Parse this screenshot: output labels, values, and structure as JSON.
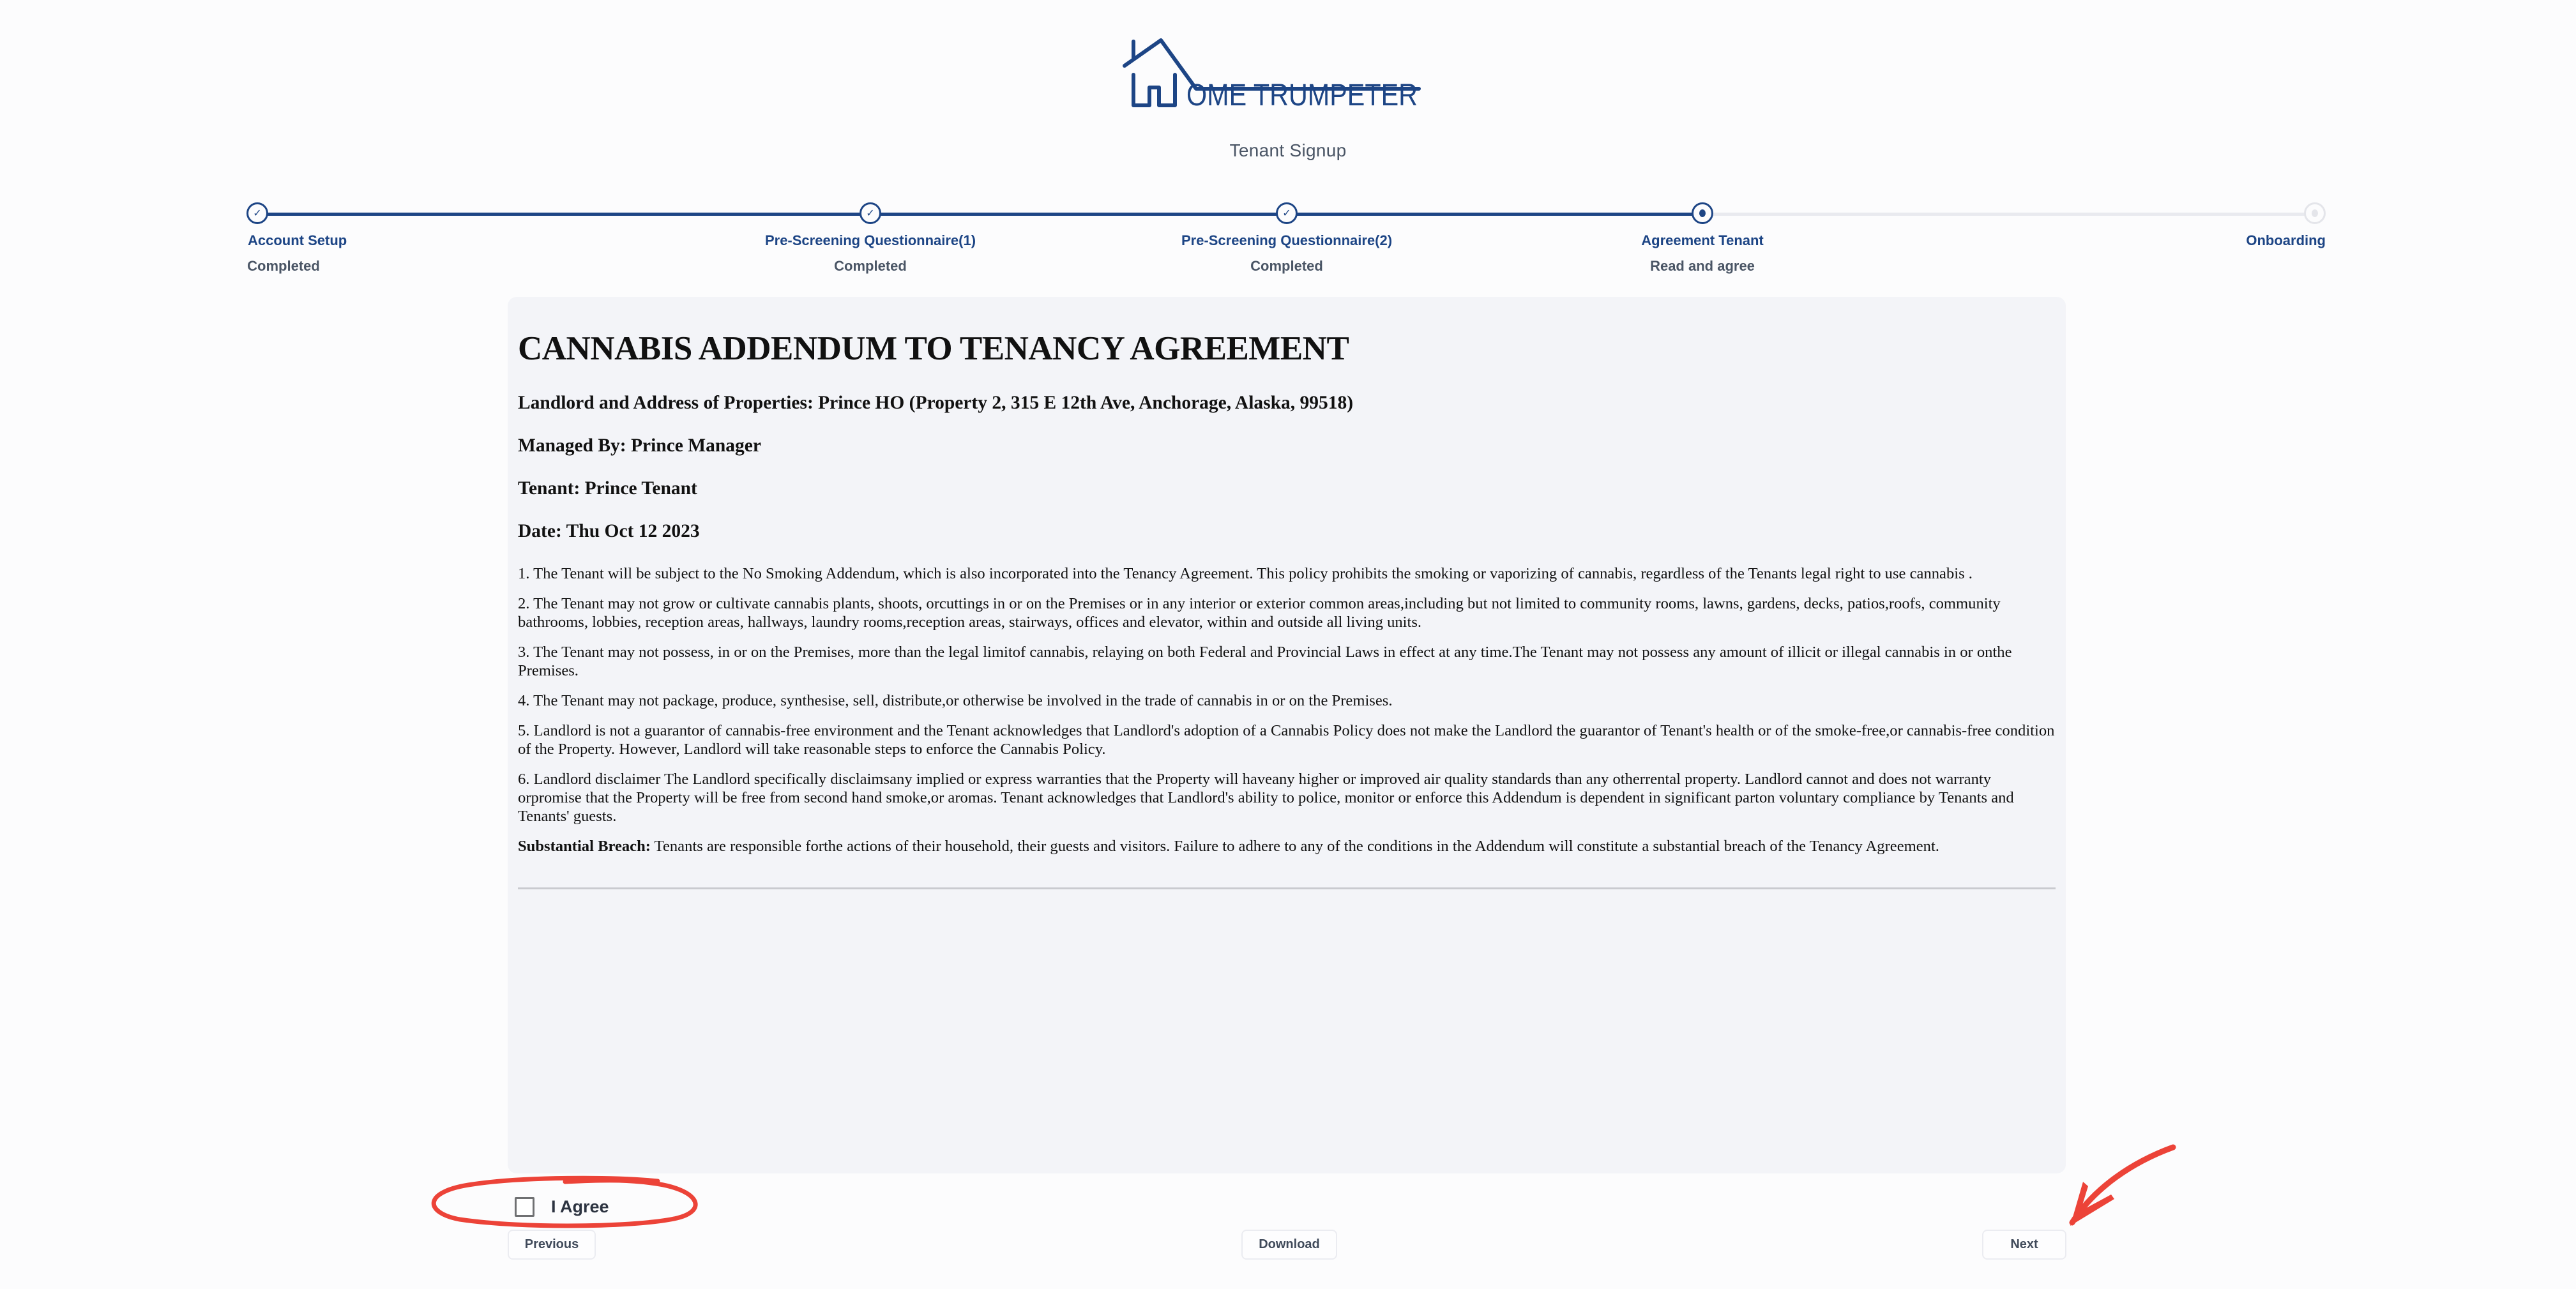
{
  "brand": {
    "logo_text": "OME TRUMPETER",
    "logo_color": "#1d4585"
  },
  "subtitle": "Tenant Signup",
  "stepper": {
    "steps": [
      {
        "label": "Account Setup",
        "status": "Completed",
        "state": "done",
        "icon": "check-icon"
      },
      {
        "label": "Pre-Screening Questionnaire(1)",
        "status": "Completed",
        "state": "done",
        "icon": "check-icon"
      },
      {
        "label": "Pre-Screening Questionnaire(2)",
        "status": "Completed",
        "state": "done",
        "icon": "check-icon"
      },
      {
        "label": "Agreement Tenant",
        "status": "Read and agree",
        "state": "current",
        "icon": "dot-icon"
      },
      {
        "label": "Onboarding",
        "status": "",
        "state": "todo",
        "icon": "dot-icon"
      }
    ],
    "active_color": "#1d4585",
    "inactive_color": "#e9eaef"
  },
  "document": {
    "title": "CANNABIS ADDENDUM TO TENANCY AGREEMENT",
    "landlord": "Landlord and Address of Properties: Prince HO (Property 2, 315 E 12th Ave, Anchorage, Alaska, 99518)",
    "managed_by": "Managed By: Prince Manager",
    "tenant": "Tenant: Prince Tenant",
    "date": "Date: Thu Oct 12 2023",
    "clauses": [
      "1. The Tenant will be subject to the No Smoking Addendum, which is also incorporated into the Tenancy Agreement. This policy prohibits the smoking or vaporizing of cannabis, regardless of the Tenants legal right to use cannabis .",
      "2. The Tenant may not grow or cultivate cannabis plants, shoots, orcuttings in or on the Premises or in any interior or exterior common areas,including but not limited to community rooms, lawns, gardens, decks, patios,roofs, community bathrooms, lobbies, reception areas, hallways, laundry rooms,reception areas, stairways, offices and elevator, within and outside all living units.",
      "3. The Tenant may not possess, in or on the Premises, more than the legal limitof cannabis, relaying on both Federal and Provincial Laws in effect at any time.The Tenant may not possess any amount of illicit or illegal cannabis in or onthe Premises.",
      "4. The Tenant may not package, produce, synthesise, sell, distribute,or otherwise be involved in the trade of cannabis in or on the Premises.",
      "5. Landlord is not a guarantor of cannabis-free environment and the Tenant acknowledges that Landlord's adoption of a Cannabis Policy does not make the Landlord the guarantor of Tenant's health or of the smoke-free,or cannabis-free condition of the Property. However, Landlord will take reasonable steps to enforce the Cannabis Policy.",
      "6. Landlord disclaimer The Landlord specifically disclaimsany implied or express warranties that the Property will haveany higher or improved air quality standards than any otherrental property. Landlord cannot and does not warranty orpromise that the Property will be free from second hand smoke,or aromas. Tenant acknowledges that Landlord's ability to police, monitor or enforce this Addendum is dependent in significant parton voluntary compliance by Tenants and Tenants' guests."
    ],
    "breach_label": "Substantial Breach:",
    "breach_text": " Tenants are responsible forthe actions of their household, their guests and visitors. Failure to adhere to any of the conditions in the Addendum will constitute a substantial breach of the Tenancy Agreement."
  },
  "agree": {
    "label": "I Agree",
    "checked": false
  },
  "buttons": {
    "previous": "Previous",
    "download": "Download",
    "next": "Next"
  },
  "annotations": {
    "color": "#ec4338",
    "items": [
      "ellipse around I Agree checkbox",
      "arrow pointing to Next button"
    ]
  }
}
